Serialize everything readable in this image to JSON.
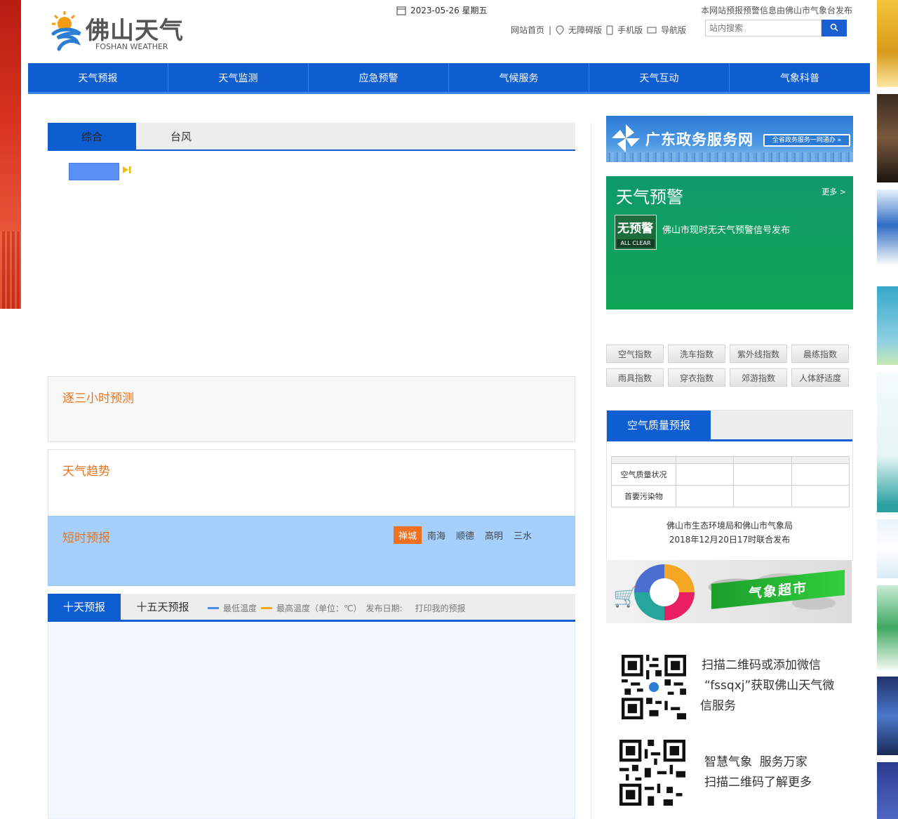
{
  "header": {
    "logo_title": "佛山天气",
    "logo_subtitle": "FOSHAN WEATHER",
    "date": "2023-05-26 星期五",
    "publisher_note": "本网站预报预警信息由佛山市气象台发布",
    "links": [
      "网站首页",
      "无障碍版",
      "手机版",
      "导航版"
    ],
    "search_placeholder": "站内搜索"
  },
  "nav": [
    "天气预报",
    "天气监测",
    "应急预警",
    "气候服务",
    "天气互动",
    "气象科普"
  ],
  "main": {
    "tabs_top": [
      "综合",
      "台风"
    ],
    "panels": {
      "three_hour": "逐三小时预测",
      "trend": "天气趋势",
      "short_term": "短时预报"
    },
    "districts": [
      "禅城",
      "南海",
      "顺德",
      "高明",
      "三水"
    ],
    "forecast_tabs": [
      "十天预报",
      "十五天预报"
    ],
    "legend": {
      "min": "最低温度",
      "max": "最高温度（单位：℃）",
      "publish": "发布日期:",
      "print": "打印我的预报",
      "min_color": "#4a90e2",
      "max_color": "#f5a623"
    }
  },
  "right": {
    "gd_banner": "广东政务服务网",
    "gd_badge": "全省政务服务一网通办 »",
    "warning": {
      "title": "天气预警",
      "more": "更多 >",
      "badge_cn": "无预警",
      "badge_en": "ALL CLEAR",
      "message": "佛山市现时无天气预警信号发布"
    },
    "indices": [
      "空气指数",
      "洗车指数",
      "紫外线指数",
      "晨练指数",
      "雨具指数",
      "穿衣指数",
      "郊游指数",
      "人体舒适度"
    ],
    "air_quality": {
      "title": "空气质量预报",
      "rows": [
        "空气质量状况",
        "首要污染物"
      ],
      "note_line1": "佛山市生态环境局和佛山市气象局",
      "note_line2": "2018年12月20日17时联合发布"
    },
    "market_label": "气象超市",
    "qr1_text": [
      "扫描二维码或添加微信",
      "“fssqxj”获取佛山天气微",
      "信服务"
    ],
    "qr2_text": [
      "智慧气象  服务万家",
      "扫描二维码了解更多"
    ]
  }
}
